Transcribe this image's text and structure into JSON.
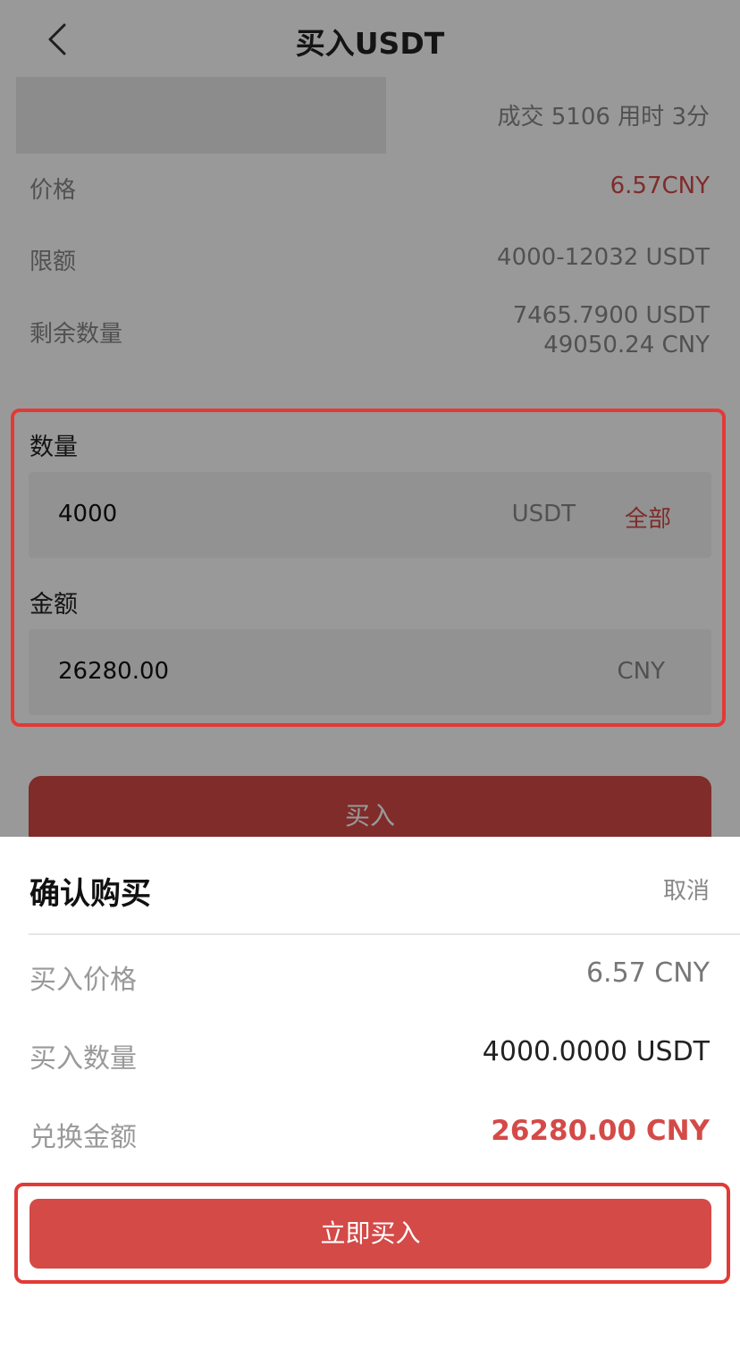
{
  "nav": {
    "title": "买入USDT"
  },
  "merchant": {
    "stats": "成交 5106 用时 3分"
  },
  "info": {
    "price": {
      "label": "价格",
      "value": "6.57CNY"
    },
    "limit": {
      "label": "限额",
      "value": "4000-12032 USDT"
    },
    "remaining": {
      "label": "剩余数量",
      "value_usdt": "7465.7900 USDT",
      "value_cny": "49050.24 CNY"
    }
  },
  "form": {
    "quantity": {
      "label": "数量",
      "value": "4000",
      "unit": "USDT",
      "all_label": "全部"
    },
    "amount": {
      "label": "金额",
      "value": "26280.00",
      "unit": "CNY"
    },
    "buy_label": "买入"
  },
  "sheet": {
    "title": "确认购买",
    "cancel": "取消",
    "rows": [
      {
        "label": "买入价格",
        "value": "6.57 CNY"
      },
      {
        "label": "买入数量",
        "value": "4000.0000 USDT"
      },
      {
        "label": "兑换金额",
        "value": "26280.00 CNY"
      }
    ],
    "confirm_label": "立即买入"
  },
  "colors": {
    "accent": "#d44a47",
    "highlight_frame": "#e23a36"
  }
}
